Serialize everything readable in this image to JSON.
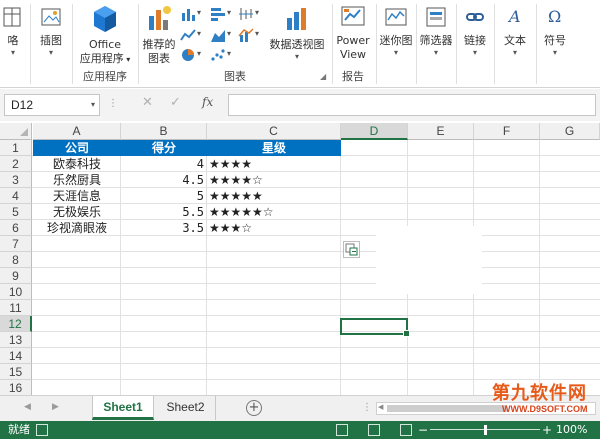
{
  "ribbon": {
    "groups": [
      {
        "label": "应用程序",
        "buttons": [
          {
            "label": "Office\n应用程序",
            "icon": "office-apps-icon"
          }
        ]
      },
      {
        "label": "图表",
        "buttons": [
          {
            "label": "推荐的\n图表",
            "icon": "recommended-charts-icon"
          },
          {
            "label": "数据透视图",
            "icon": "pivotchart-icon"
          }
        ]
      },
      {
        "label": "报告",
        "buttons": [
          {
            "label": "Power\nView",
            "icon": "power-view-icon"
          }
        ]
      }
    ],
    "labels": {
      "partial_left": "咯",
      "illustrations": "插图",
      "office_line1": "Office",
      "office_line2": "应用程序",
      "recommended_line1": "推荐的",
      "recommended_line2": "图表",
      "pivotchart": "数据透视图",
      "powerview_line1": "Power",
      "powerview_line2": "View",
      "sparklines": "迷你图",
      "slicer": "筛选器",
      "link": "链接",
      "text": "文本",
      "symbol": "符号",
      "grp_apps": "应用程序",
      "grp_charts": "图表",
      "grp_reports": "报告"
    }
  },
  "formula_bar": {
    "name_box": "D12",
    "fx": "fx",
    "value": ""
  },
  "grid": {
    "columns": [
      "A",
      "B",
      "C",
      "D",
      "E",
      "F",
      "G"
    ],
    "selected_column": "D",
    "rows": [
      "1",
      "2",
      "3",
      "4",
      "5",
      "6",
      "7",
      "8",
      "9",
      "10",
      "11",
      "12",
      "13",
      "14",
      "15",
      "16"
    ],
    "selected_row": "12",
    "header_row": {
      "company": "公司",
      "score": "得分",
      "rating": "星级"
    },
    "data": [
      {
        "company": "欧泰科技",
        "score": "4",
        "stars": "★★★★"
      },
      {
        "company": "乐然厨具",
        "score": "4.5",
        "stars": "★★★★☆"
      },
      {
        "company": "天涯信息",
        "score": "5",
        "stars": "★★★★★"
      },
      {
        "company": "无极娱乐",
        "score": "5.5",
        "stars": "★★★★★☆"
      },
      {
        "company": "珍视滴眼液",
        "score": "3.5",
        "stars": "★★★☆"
      }
    ],
    "header_fill": "#0070c0",
    "selection_color": "#217346"
  },
  "sheets": {
    "tabs": [
      "Sheet1",
      "Sheet2"
    ],
    "active": "Sheet1",
    "add_label": "+"
  },
  "status": {
    "ready": "就绪",
    "zoom": "100%",
    "zoom_minus": "−",
    "zoom_plus": "+"
  },
  "watermark": {
    "brand": "第九软件网",
    "url": "WWW.D9SOFT.COM"
  }
}
